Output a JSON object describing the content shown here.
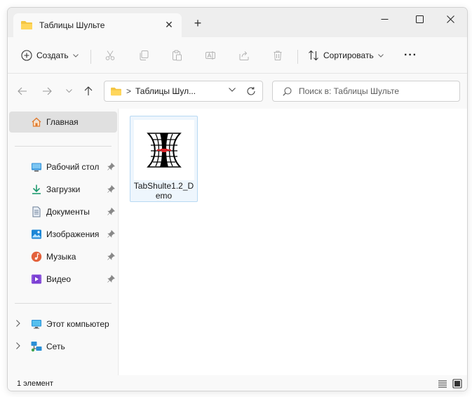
{
  "window": {
    "tab_title": "Таблицы Шульте",
    "new_tab_symbol": "+"
  },
  "toolbar": {
    "create_label": "Создать",
    "sort_label": "Сортировать",
    "more_label": "···"
  },
  "address": {
    "separator": ">",
    "path": "Таблицы Шул..."
  },
  "search": {
    "placeholder": "Поиск в: Таблицы Шульте"
  },
  "sidebar": {
    "home": "Главная",
    "pinned": [
      {
        "label": "Рабочий стол",
        "icon": "desktop-icon"
      },
      {
        "label": "Загрузки",
        "icon": "downloads-icon"
      },
      {
        "label": "Документы",
        "icon": "documents-icon"
      },
      {
        "label": "Изображения",
        "icon": "pictures-icon"
      },
      {
        "label": "Музыка",
        "icon": "music-icon"
      },
      {
        "label": "Видео",
        "icon": "video-icon"
      }
    ],
    "this_pc": "Этот компьютер",
    "network": "Сеть"
  },
  "files": [
    {
      "name": "TabShulte1.2_Demo",
      "icon": "tabshulte-app-icon"
    }
  ],
  "status": {
    "item_count": "1 элемент"
  },
  "colors": {
    "folder": "#f4c542",
    "accent": "#0067c0",
    "selection_bg": "#eef6fd",
    "selection_border": "#b8d9f3"
  }
}
